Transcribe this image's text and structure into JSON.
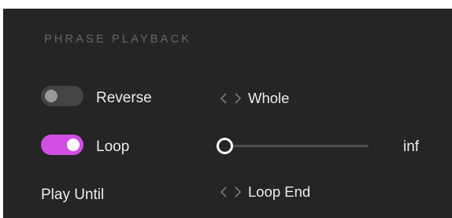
{
  "section": {
    "title": "PHRASE PLAYBACK"
  },
  "reverse": {
    "label": "Reverse",
    "enabled": false,
    "mode_value": "Whole",
    "mode_icon": "chevron-left-right-icon"
  },
  "loop": {
    "label": "Loop",
    "enabled": true,
    "count_value": "inf",
    "slider_fraction": 0.0
  },
  "play_until": {
    "label": "Play Until",
    "value": "Loop End",
    "icon": "chevron-left-right-icon"
  },
  "colors": {
    "panel_bg": "#252525",
    "accent": "#d14fe3",
    "toggle_off_bg": "#444444",
    "toggle_off_knob": "#9a9a9a",
    "title_color": "#666666",
    "text_color": "#ececec",
    "chevron_color": "#7a7a7a"
  }
}
